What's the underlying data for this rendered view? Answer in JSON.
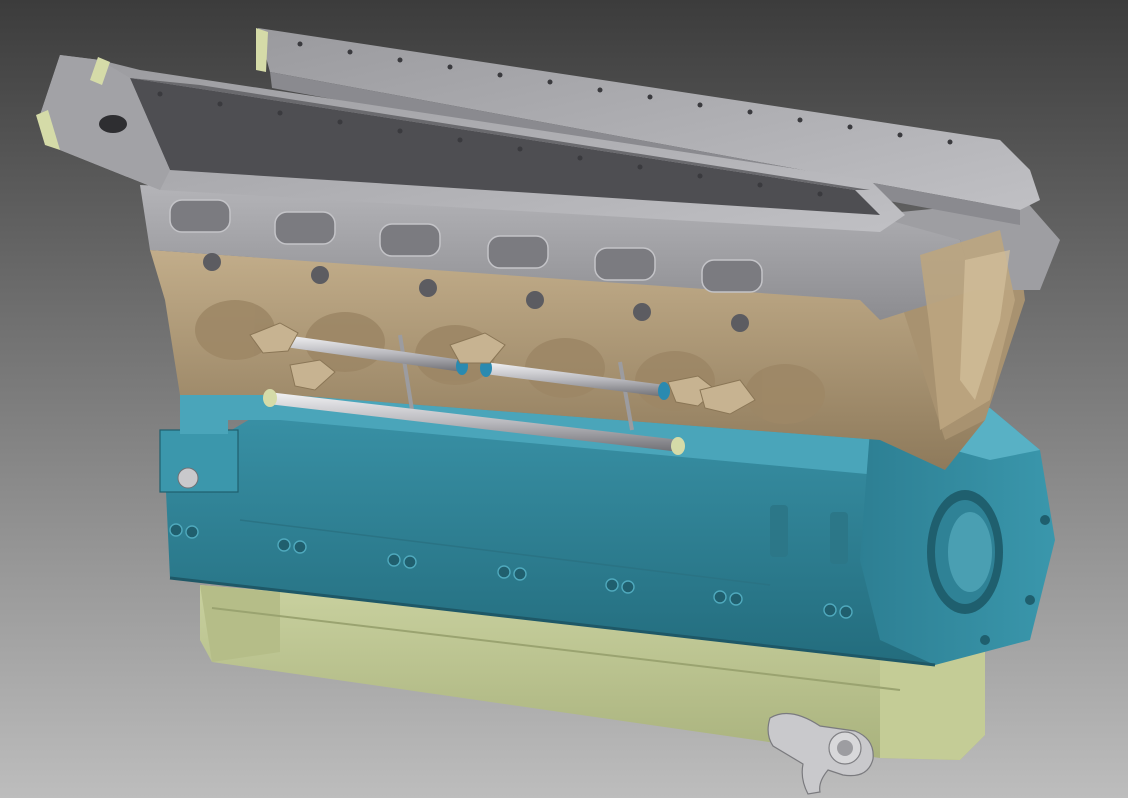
{
  "viewport": {
    "background_top": "#3c3c3c",
    "background_bottom": "#bdbdbd"
  },
  "model": {
    "parts": [
      {
        "name": "cylinder-head-cover",
        "color": "#a8a8ab"
      },
      {
        "name": "cylinder-block",
        "color": "#b8a484"
      },
      {
        "name": "crankcase",
        "color": "#2f8296"
      },
      {
        "name": "oil-sump",
        "color": "#bcc594"
      },
      {
        "name": "rocker-shafts",
        "color": "#cfcfd4"
      },
      {
        "name": "shaft-end-rings",
        "color": "#2a8ab0"
      }
    ]
  }
}
